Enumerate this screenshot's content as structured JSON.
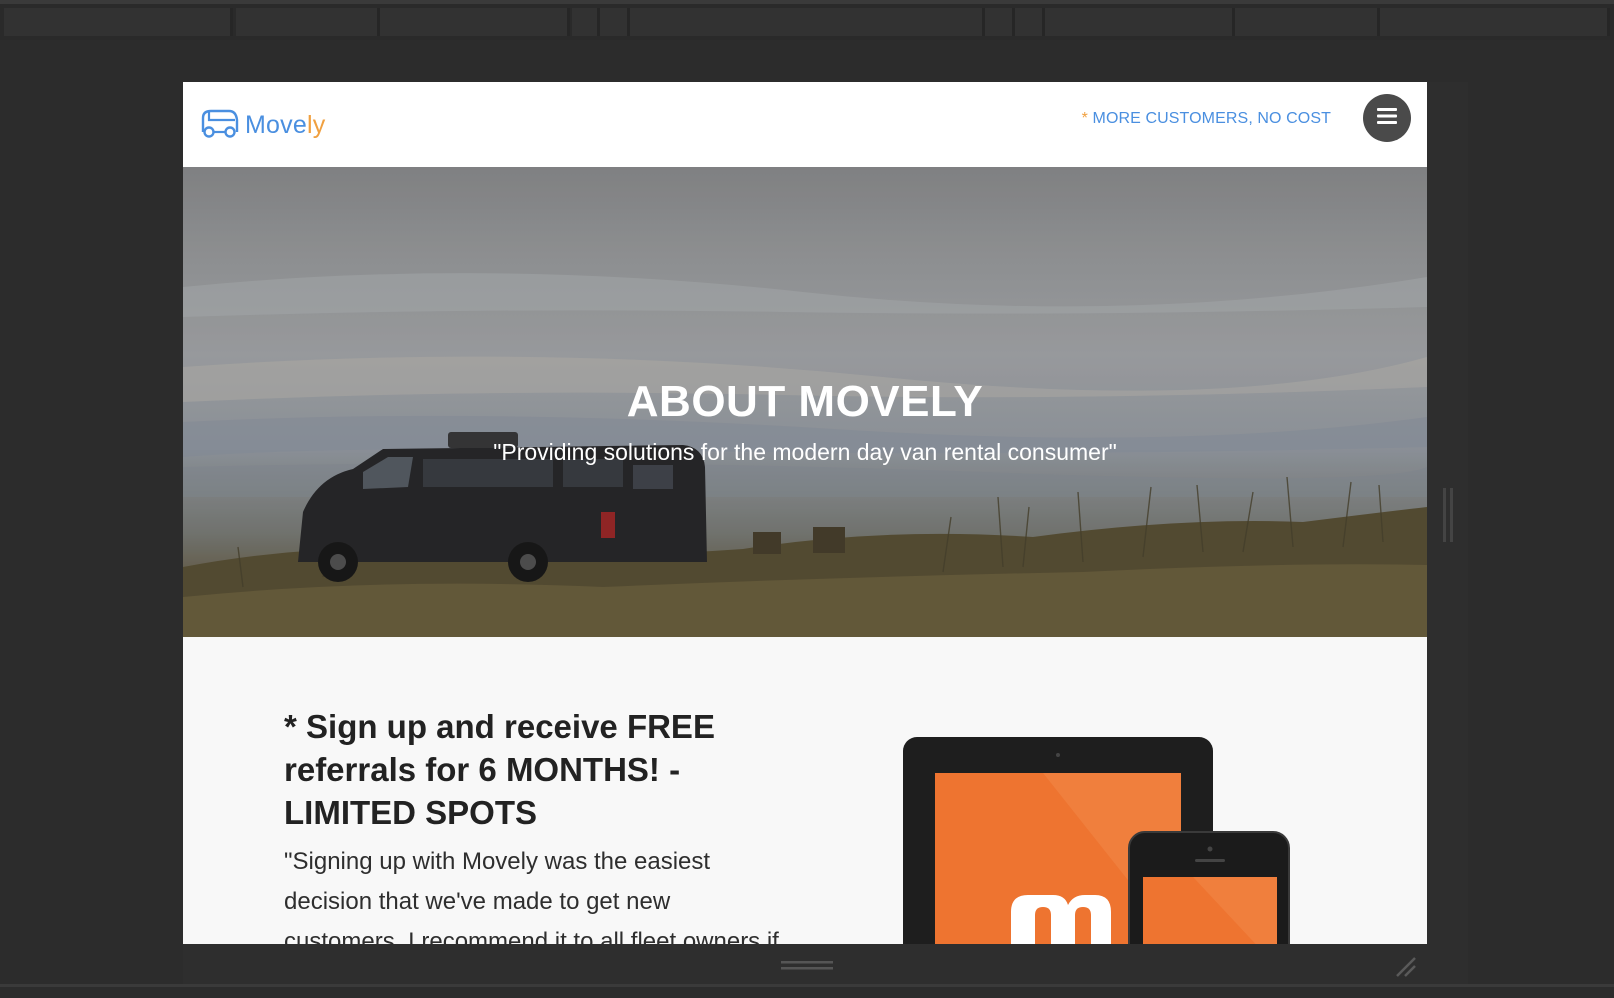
{
  "header": {
    "logo_text_main": "Move",
    "logo_text_accent": "ly",
    "logo_icon": "van-outline-icon",
    "promo_star": "*",
    "promo_link": "MORE CUSTOMERS, NO COST",
    "menu_icon": "hamburger-menu-icon"
  },
  "hero": {
    "title": "ABOUT MOVELY",
    "subtitle": "\"Providing solutions for the modern day van rental consumer\""
  },
  "content": {
    "heading": "* Sign up and receive FREE referrals for 6 MONTHS! -LIMITED SPOTS",
    "testimonial": "\"Signing up with Movely was the easiest decision that we've made to get new customers. I recommend it to all fleet owners if",
    "image_icon": "tablet-and-phone-devices-icon"
  },
  "colors": {
    "brand_blue": "#4a8fe0",
    "brand_orange": "#f0a040",
    "device_orange": "#ee7430"
  }
}
